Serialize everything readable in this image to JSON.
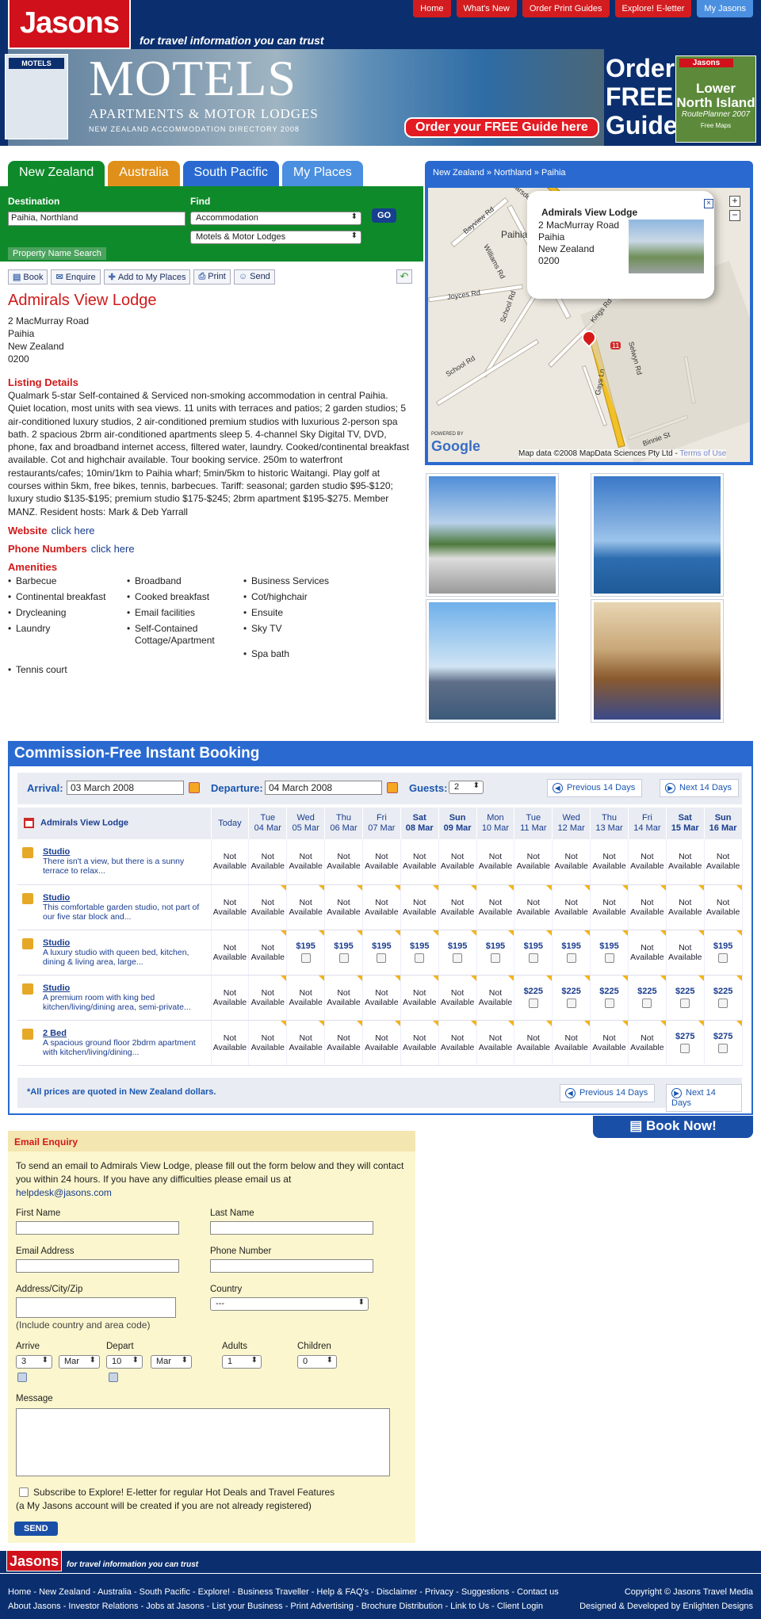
{
  "header": {
    "logo": "Jasons",
    "tagline": "for travel information you can trust",
    "nav": [
      "Home",
      "What's New",
      "Order Print Guides",
      "Explore! E-letter",
      "My Jasons"
    ]
  },
  "banner": {
    "title": "MOTELS",
    "subtitle": "APARTMENTS & MOTOR LODGES",
    "directory": "NEW ZEALAND ACCOMMODATION DIRECTORY 2008",
    "order_button": "Order your FREE Guide here",
    "order_free": "Order FREE Guides",
    "thumb_title": "MOTELS",
    "lni_brand": "Jasons",
    "lni_title": "Lower North Island",
    "lni_sub": "RoutePlanner 2007",
    "lni_top": "Free Maps"
  },
  "tabs": [
    {
      "label": "New Zealand",
      "color": "#0f8a2a"
    },
    {
      "label": "Australia",
      "color": "#e0901a"
    },
    {
      "label": "South Pacific",
      "color": "#2a6ad0"
    },
    {
      "label": "My Places",
      "color": "#4a8fe0"
    }
  ],
  "search": {
    "dest_label": "Destination",
    "find_label": "Find",
    "destination": "Paihia, Northland",
    "find": "Accommodation",
    "type": "Motels & Motor Lodges",
    "go": "GO",
    "prop_search": "Property Name Search"
  },
  "toolbar": [
    "Book",
    "Enquire",
    "Add to My Places",
    "Print",
    "Send"
  ],
  "listing": {
    "name": "Admirals View Lodge",
    "address": [
      "2 MacMurray Road",
      "Paihia",
      "New Zealand",
      "0200"
    ],
    "details_heading": "Listing Details",
    "description": "Qualmark 5-star Self-contained & Serviced non-smoking accommodation in central Paihia. Quiet location, most units with sea views. 11 units with terraces and patios; 2 garden studios; 5 air-conditioned luxury studios, 2 air-conditioned premium studios with luxurious 2-person spa bath. 2 spacious 2brm air-conditioned apartments sleep 5. 4-channel Sky Digital TV, DVD, phone, fax and broadband internet access, filtered water, laundry. Cooked/continental breakfast available. Cot and highchair available. Tour booking service. 250m to waterfront restaurants/cafes; 10min/1km to Paihia wharf; 5min/5km to historic Waitangi. Play golf at courses within 5km, free bikes, tennis, barbecues. Tariff: seasonal; garden studio $95-$120; luxury studio $135-$195; premium studio $175-$245; 2brm apartment $195-$275. Member MANZ. Resident hosts: Mark & Deb Yarrall",
    "website_label": "Website",
    "phone_label": "Phone Numbers",
    "click_here": "click here",
    "amenities_heading": "Amenities",
    "amenities": [
      "Barbecue",
      "Broadband",
      "Business Services",
      "Continental breakfast",
      "Cooked breakfast",
      "Cot/highchair",
      "Drycleaning",
      "Email facilities",
      "Ensuite",
      "Laundry",
      "Self-Contained Cottage/Apartment",
      "Sky TV",
      "Spa bath",
      "",
      "",
      " Tennis court"
    ]
  },
  "map": {
    "breadcrumb": "New Zealand » Northland » Paihia",
    "popup_title": "Admirals View Lodge",
    "popup_address": [
      "2 MacMurray Road",
      "Paihia",
      "New Zealand",
      "0200"
    ],
    "roads": [
      "Bayview Rd",
      "Marsden Rd",
      "Paihia",
      "Williams Rd",
      "Joyces Rd",
      "School Rd",
      "Kings Rd",
      "School Rd",
      "Selwyn Rd",
      "Gays Ln",
      "Binnie St",
      "11"
    ],
    "powered": "POWERED BY",
    "google": "Google",
    "copyright": "Map data ©2008 MapData Sciences Pty Ltd -",
    "terms": "Terms of Use"
  },
  "booking": {
    "title": "Commission-Free Instant Booking",
    "arrival_label": "Arrival:",
    "arrival": "03 March 2008",
    "departure_label": "Departure:",
    "departure": "04 March 2008",
    "guests_label": "Guests:",
    "guests": "2",
    "prev": "Previous 14 Days",
    "next": "Next 14 Days",
    "property": "Admirals View Lodge",
    "note": "*All prices are quoted in New Zealand dollars.",
    "book_now": "Book Now!",
    "days": [
      {
        "d": "Today",
        "dt": "",
        "we": false
      },
      {
        "d": "Tue",
        "dt": "04 Mar",
        "we": false
      },
      {
        "d": "Wed",
        "dt": "05 Mar",
        "we": false
      },
      {
        "d": "Thu",
        "dt": "06 Mar",
        "we": false
      },
      {
        "d": "Fri",
        "dt": "07 Mar",
        "we": false
      },
      {
        "d": "Sat",
        "dt": "08 Mar",
        "we": true
      },
      {
        "d": "Sun",
        "dt": "09 Mar",
        "we": true
      },
      {
        "d": "Mon",
        "dt": "10 Mar",
        "we": false
      },
      {
        "d": "Tue",
        "dt": "11 Mar",
        "we": false
      },
      {
        "d": "Wed",
        "dt": "12 Mar",
        "we": false
      },
      {
        "d": "Thu",
        "dt": "13 Mar",
        "we": false
      },
      {
        "d": "Fri",
        "dt": "14 Mar",
        "we": false
      },
      {
        "d": "Sat",
        "dt": "15 Mar",
        "we": true
      },
      {
        "d": "Sun",
        "dt": "16 Mar",
        "we": true
      }
    ],
    "rooms": [
      {
        "name": "Studio",
        "desc": "There isn't a view, but there is a sunny terrace to relax...",
        "cells": [
          "NA",
          "NA",
          "NA",
          "NA",
          "NA",
          "NA",
          "NA",
          "NA",
          "NA",
          "NA",
          "NA",
          "NA",
          "NA",
          "NA"
        ]
      },
      {
        "name": "Studio",
        "desc": "This comfortable garden studio, not part of our five star block and...",
        "cells": [
          "NA",
          "NA",
          "NA",
          "NA",
          "NA",
          "NA",
          "NA",
          "NA",
          "NA",
          "NA",
          "NA",
          "NA",
          "NA",
          "NA"
        ]
      },
      {
        "name": "Studio",
        "desc": "A luxury studio with queen bed, kitchen, dining & living area, large...",
        "cells": [
          "NA",
          "NA",
          "$195",
          "$195",
          "$195",
          "$195",
          "$195",
          "$195",
          "$195",
          "$195",
          "$195",
          "NA",
          "NA",
          "$195"
        ]
      },
      {
        "name": "Studio",
        "desc": "A premium room with king bed kitchen/living/dining area, semi-private...",
        "cells": [
          "NA",
          "NA",
          "NA",
          "NA",
          "NA",
          "NA",
          "NA",
          "NA",
          "$225",
          "$225",
          "$225",
          "$225",
          "$225",
          "$225"
        ]
      },
      {
        "name": "2 Bed",
        "desc": "A spacious ground floor 2bdrm apartment with kitchen/living/dining...",
        "cells": [
          "NA",
          "NA",
          "NA",
          "NA",
          "NA",
          "NA",
          "NA",
          "NA",
          "NA",
          "NA",
          "NA",
          "NA",
          "$275",
          "$275"
        ]
      }
    ],
    "not_available": "Not Available"
  },
  "enquiry": {
    "heading": "Email Enquiry",
    "intro": "To send an email to Admirals View Lodge, please fill out the form below and they will contact you within 24 hours. If you have any difficulties please email us at",
    "email": "helpdesk@jasons.com",
    "first": "First Name",
    "last": "Last Name",
    "emailaddr": "Email Address",
    "phone": "Phone Number",
    "address": "Address/City/Zip",
    "country": "Country",
    "country_val": "---",
    "hint": "(Include country and area code)",
    "arrive": "Arrive",
    "depart": "Depart",
    "adults": "Adults",
    "children": "Children",
    "arr_day": "3",
    "arr_mon": "Mar",
    "dep_day": "10",
    "dep_mon": "Mar",
    "adults_val": "1",
    "children_val": "0",
    "message": "Message",
    "subscribe": "Subscribe to Explore! E-letter for regular Hot Deals and Travel Features",
    "account_note": "(a My Jasons account will be created if you are not already registered)",
    "send": "SEND"
  },
  "footer": {
    "logo": "Jasons",
    "tagline": "for travel information you can trust",
    "line1": "Home - New Zealand - Australia - South Pacific - Explore! - Business Traveller - Help & FAQ's - Disclaimer - Privacy - Suggestions - Contact us",
    "line2": "About Jasons - Investor Relations - Jobs at Jasons - List your Business - Print Advertising - Brochure Distribution - Link to Us - Client Login",
    "copyright": "Copyright © Jasons Travel Media",
    "designed": "Designed & Developed by Enlighten Designs"
  }
}
